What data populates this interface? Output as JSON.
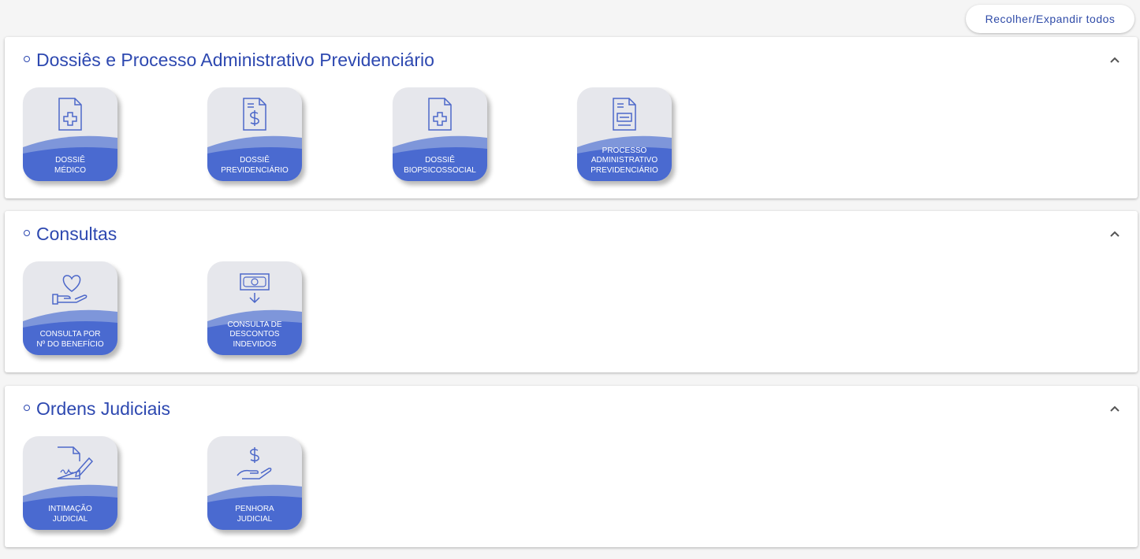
{
  "toolbar": {
    "toggle_all_label": "Recolher/Expandir todos"
  },
  "colors": {
    "accent": "#2d48b0",
    "tile_blue": "#4a6ad0",
    "tile_wave_light": "#7e96da",
    "tile_bg": "#e6e7ec",
    "icon_stroke": "#4d68c9"
  },
  "sections": [
    {
      "title": "Dossiês e Processo Administrativo Previdenciário",
      "tiles": [
        {
          "icon": "medical-document-icon",
          "lines": [
            "DOSSIÊ",
            "MÉDICO"
          ]
        },
        {
          "icon": "money-document-icon",
          "lines": [
            "DOSSIÊ",
            "PREVIDENCIÁRIO"
          ]
        },
        {
          "icon": "medical-document-icon",
          "lines": [
            "DOSSIÊ",
            "BIOPSICOSSOCIAL"
          ]
        },
        {
          "icon": "form-document-icon",
          "lines": [
            "PROCESSO",
            "ADMINISTRATIVO",
            "PREVIDENCIÁRIO"
          ]
        }
      ]
    },
    {
      "title": "Consultas",
      "tiles": [
        {
          "icon": "heart-hand-icon",
          "lines": [
            "CONSULTA POR",
            "Nº DO BENEFÍCIO"
          ]
        },
        {
          "icon": "banknote-down-icon",
          "lines": [
            "CONSULTA DE",
            "DESCONTOS",
            "INDEVIDOS"
          ]
        }
      ]
    },
    {
      "title": "Ordens Judiciais",
      "tiles": [
        {
          "icon": "signature-document-icon",
          "lines": [
            "INTIMAÇÃO",
            "JUDICIAL"
          ]
        },
        {
          "icon": "money-hand-icon",
          "lines": [
            "PENHORA",
            "JUDICIAL"
          ]
        }
      ]
    }
  ]
}
